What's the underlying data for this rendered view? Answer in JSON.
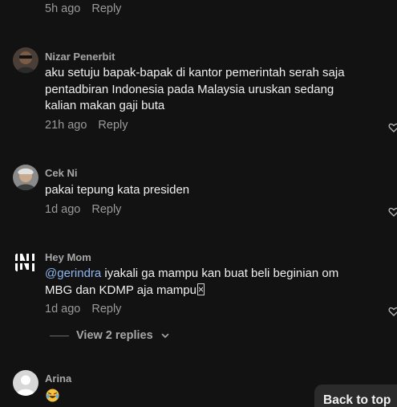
{
  "top_meta": {
    "time": "5h ago",
    "reply_label": "Reply"
  },
  "comments": [
    {
      "author": "Nizar Penerbit",
      "text_lines": [
        "aku setuju bapak-bapak di kantor pemerintah serah saja",
        "pentadbiran Indonesia pada Malaysia uruskan sedang",
        "kalian makan gaji buta"
      ],
      "time": "21h ago",
      "reply_label": "Reply"
    },
    {
      "author": "Cek Ni",
      "text": "pakai tepung kata presiden",
      "time": "1d ago",
      "reply_label": "Reply"
    },
    {
      "author": "Hey Mom",
      "mention": "@gerindra",
      "text_line1": " iyakali ga mampu kan buat beli beginian om",
      "text_line2": "MBG dan KDMP aja mampu",
      "time": "1d ago",
      "reply_label": "Reply"
    },
    {
      "author": "Arina",
      "text": "😂"
    }
  ],
  "view_replies_label": "View 2 replies",
  "back_to_top_label": "Back to top",
  "colors": {
    "background": "#121212",
    "text": "#f0f0f0",
    "muted": "#9a9a9a",
    "mention": "#8fb6f0"
  },
  "icons": [
    "heart-icon",
    "chevron-down-icon",
    "avatar-default-icon"
  ]
}
